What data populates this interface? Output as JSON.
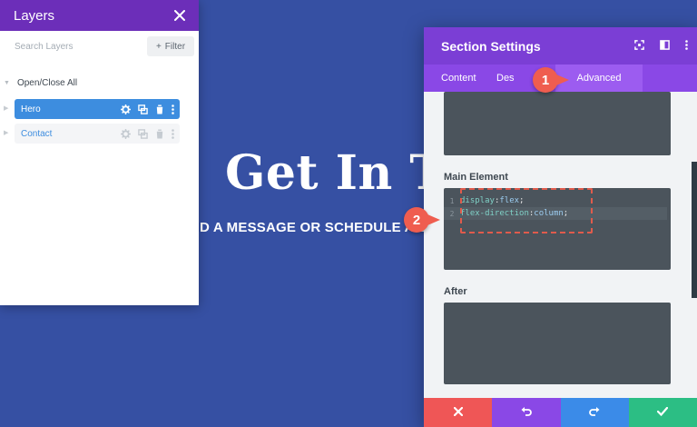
{
  "hero": {
    "title": "Get In To",
    "subtitle": "D A MESSAGE OR SCHEDULE A BO"
  },
  "layers_panel": {
    "title": "Layers",
    "close_icon": "close-icon",
    "search_placeholder": "Search Layers",
    "filter_label": "Filter",
    "open_close_all": "Open/Close All",
    "items": [
      {
        "label": "Hero",
        "state": "active"
      },
      {
        "label": "Contact",
        "state": "inactive"
      }
    ]
  },
  "section_settings": {
    "title": "Section Settings",
    "header_icons": [
      "fullscreen-icon",
      "split-view-icon",
      "more-options-icon"
    ],
    "tabs": [
      {
        "label": "Content"
      },
      {
        "label": "Des"
      },
      {
        "label": "Advanced",
        "active": true
      }
    ],
    "fields": {
      "main_element_label": "Main Element",
      "after_label": "After"
    },
    "code": [
      {
        "line": "1",
        "property": "display",
        "sep": ":",
        "value": "flex",
        "end": ";"
      },
      {
        "line": "2",
        "property": "flex-direction",
        "sep": ": ",
        "value": "column",
        "end": ";"
      }
    ],
    "footer": [
      "cancel-icon",
      "undo-icon",
      "redo-icon",
      "save-check-icon"
    ]
  },
  "callouts": [
    "1",
    "2"
  ],
  "colors": {
    "background": "#3650a3",
    "purple_header": "#7b3ed5",
    "purple_tabs": "#8a48e6",
    "accent_blue": "#3d8ddf",
    "callout_red": "#ef5d4f",
    "cancel_red": "#ef5656",
    "save_green": "#2cbe84"
  }
}
